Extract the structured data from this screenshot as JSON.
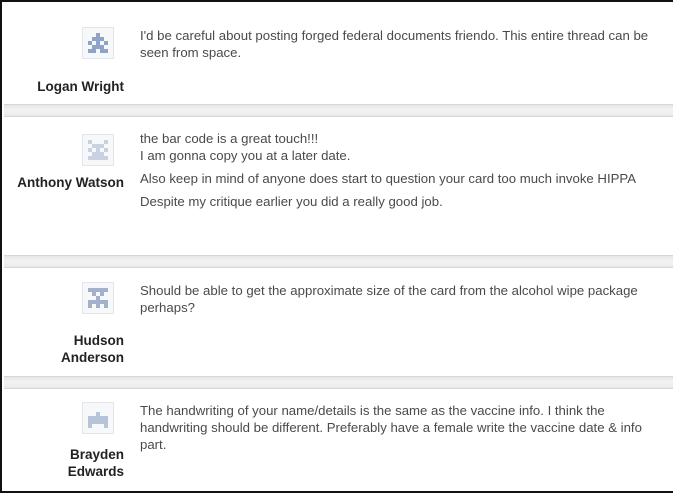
{
  "posts": [
    {
      "author": "Logan Wright",
      "avatar_icon": "identicon-avatar-icon",
      "avatar_color": "#8fa3c8",
      "messages": [
        "I'd be careful about posting forged federal documents friendo. This entire thread can be seen from space."
      ]
    },
    {
      "author": "Anthony Watson",
      "avatar_icon": "identicon-avatar-icon",
      "avatar_color": "#c9d2e2",
      "messages": [
        "the bar code is a great touch!!!",
        "I am gonna copy you at a later date.",
        "Also keep in mind of anyone does start to question your card too much invoke HIPPA",
        "Despite my critique earlier you did a really good job."
      ]
    },
    {
      "author": "Hudson Anderson",
      "avatar_icon": "identicon-avatar-icon",
      "avatar_color": "#a2b1cc",
      "messages": [
        "Should be able to get the approximate size of the card from the alcohol wipe package perhaps?"
      ]
    },
    {
      "author": "Brayden Edwards",
      "avatar_icon": "identicon-avatar-icon",
      "avatar_color": "#b7c3d8",
      "messages": [
        "The handwriting of your name/details is the same as the vaccine info. I think the handwriting should be different. Preferably have a female write the vaccine date & info part."
      ]
    }
  ]
}
